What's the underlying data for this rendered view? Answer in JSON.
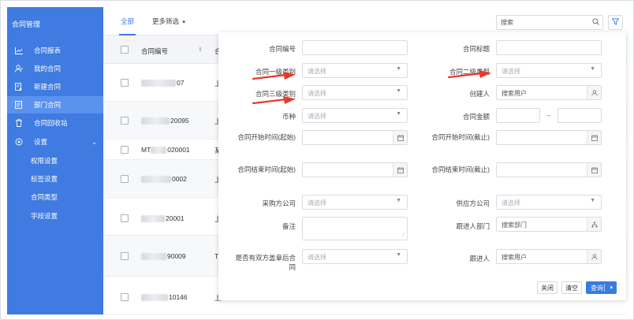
{
  "sidebar": {
    "title": "合同管理",
    "items": [
      {
        "label": "合同报表",
        "icon": "chart-icon"
      },
      {
        "label": "我的合同",
        "icon": "user-icon"
      },
      {
        "label": "新建合同",
        "icon": "doc-add-icon"
      },
      {
        "label": "部门合同",
        "icon": "doc-icon"
      },
      {
        "label": "合同回收站",
        "icon": "trash-icon"
      },
      {
        "label": "设置",
        "icon": "gear-icon"
      }
    ],
    "sub_items": [
      "权限设置",
      "标签设置",
      "合同类型",
      "字段设置"
    ],
    "accent": "#3f7be0",
    "active_item": "部门合同"
  },
  "tabs": [
    {
      "label": "全部"
    },
    {
      "label": "更多筛选"
    }
  ],
  "search": {
    "placeholder": "搜索"
  },
  "table": {
    "headers": [
      "合同编号",
      "合"
    ],
    "rows": [
      {
        "code_visible": "07",
        "next": "上"
      },
      {
        "code_visible": "20095",
        "next": "上"
      },
      {
        "code_visible": "020001",
        "prefix": "MT",
        "next": "某"
      },
      {
        "code_visible": "0002",
        "next": "上"
      },
      {
        "code_visible": "20001",
        "next": "上"
      },
      {
        "code_visible": "90009",
        "next": "T"
      },
      {
        "code_visible": "10146",
        "next": "上"
      }
    ]
  },
  "filter": {
    "fields": {
      "contract_no": {
        "label": "合同编号"
      },
      "contract_title": {
        "label": "合同标题"
      },
      "cat1": {
        "label": "合同一级类别",
        "placeholder": "请选择"
      },
      "cat2": {
        "label": "合同二级类型",
        "placeholder": "请选择"
      },
      "cat3": {
        "label": "合同三级类别",
        "placeholder": "请选择"
      },
      "creator": {
        "label": "创建人",
        "placeholder": "搜索用户"
      },
      "currency": {
        "label": "币种",
        "placeholder": "请选择"
      },
      "amount": {
        "label": "合同金额",
        "separator": "--"
      },
      "start_from": {
        "label": "合同开始时间(起始)"
      },
      "start_to": {
        "label": "合同开始时间(截止)"
      },
      "end_from": {
        "label": "合同结束时间(起始)"
      },
      "end_to": {
        "label": "合同结束时间(截止)"
      },
      "purchaser": {
        "label": "采购方公司",
        "placeholder": "请选择"
      },
      "supplier": {
        "label": "供应方公司",
        "placeholder": "请选择"
      },
      "remark": {
        "label": "备注"
      },
      "follow_dept": {
        "label": "跟进人部门",
        "placeholder": "搜索部门"
      },
      "both_stamped": {
        "label": "是否有双方盖章后合同",
        "placeholder": "请选择"
      },
      "follower": {
        "label": "跟进人",
        "placeholder": "搜索用户"
      }
    },
    "buttons": {
      "close": "关闭",
      "clear": "清空",
      "query": "查询"
    }
  },
  "annotation_color": "#e8392c"
}
